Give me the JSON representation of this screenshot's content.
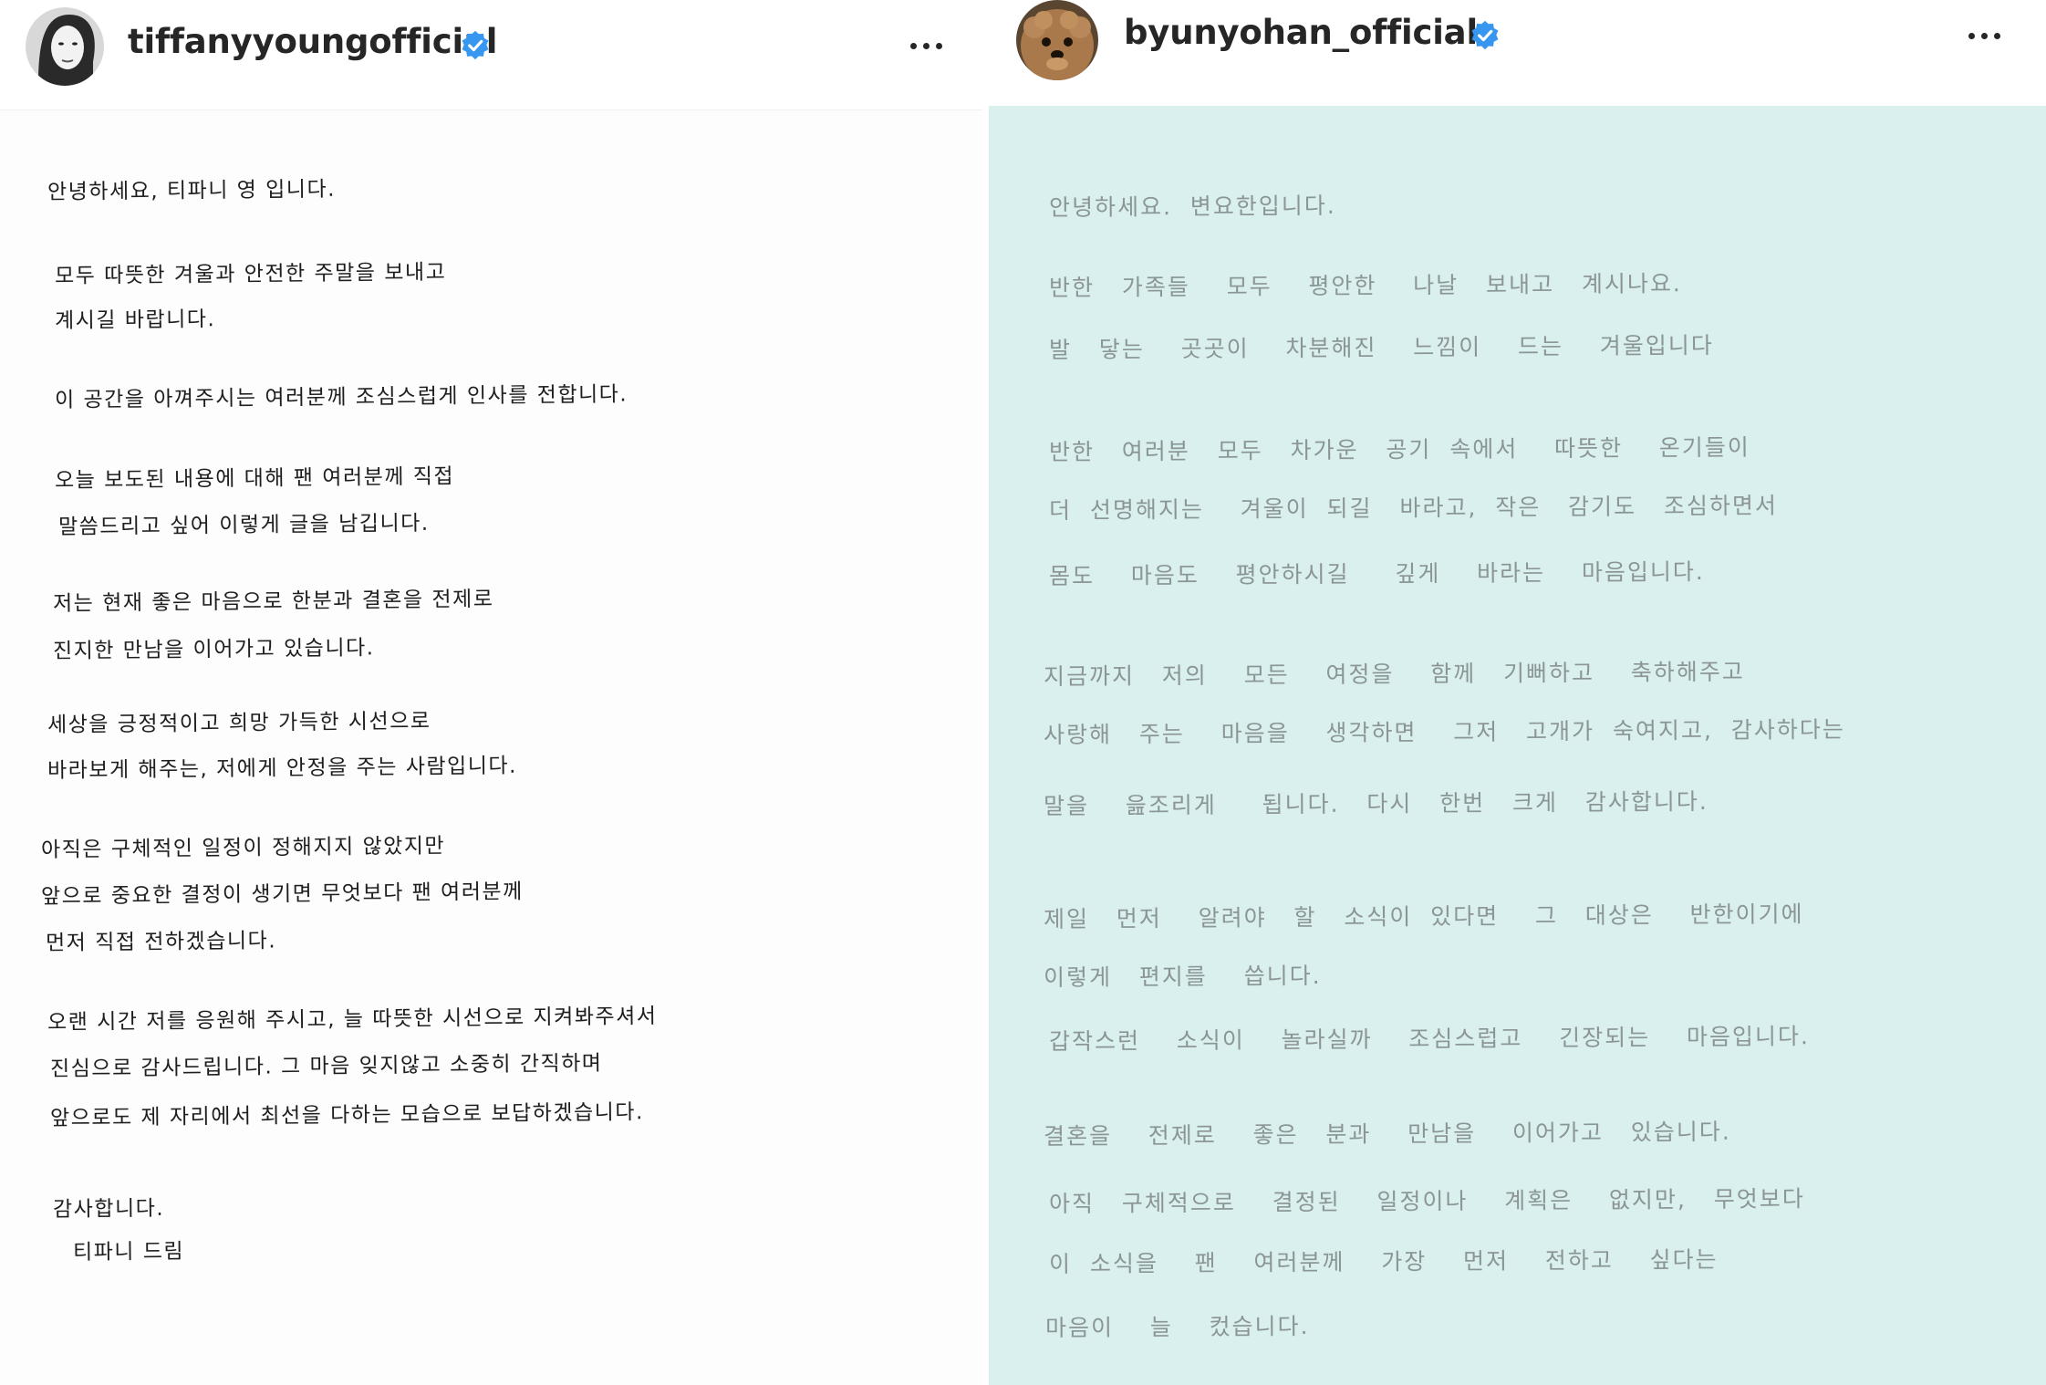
{
  "left_post": {
    "username": "tiffanyyoungofficial",
    "verified": true,
    "menu_icon": "more-horizontal-icon",
    "letter_background": "#fdfdfd",
    "letter_lines": [
      "안녕하세요, 티파니 영 입니다.",
      "모두 따뜻한 겨울과 안전한 주말을 보내고",
      "계시길 바랍니다.",
      "이 공간을 아껴주시는 여러분께 조심스럽게 인사를 전합니다.",
      "오늘 보도된 내용에 대해 팬 여러분께 직접",
      "말씀드리고 싶어 이렇게 글을 남깁니다.",
      "저는 현재 좋은 마음으로 한분과 결혼을 전제로",
      "진지한 만남을 이어가고 있습니다.",
      "세상을 긍정적이고 희망 가득한 시선으로",
      "바라보게 해주는, 저에게 안정을 주는 사람입니다.",
      "아직은 구체적인 일정이 정해지지 않았지만",
      "앞으로 중요한 결정이 생기면 무엇보다 팬 여러분께",
      "먼저 직접 전하겠습니다.",
      "오랜 시간 저를 응원해 주시고, 늘 따뜻한 시선으로 지켜봐주셔서",
      "진심으로 감사드립니다. 그 마음 잊지않고 소중히 간직하며",
      "앞으로도 제 자리에서 최선을 다하는 모습으로 보답하겠습니다.",
      "감사합니다.",
      "티파니 드림"
    ]
  },
  "right_post": {
    "username": "byunyohan_official",
    "verified": true,
    "menu_icon": "more-horizontal-icon",
    "letter_background": "#d9f0ef",
    "letter_lines": [
      "안녕하세요.  변요한입니다.",
      "반한   가족들    모두    평안한    나날   보내고   계시나요.",
      "발   닿는    곳곳이    차분해진    느낌이    드는    겨울입니다",
      "반한   여러분   모두   차가운   공기  속에서    따뜻한    온기들이",
      "더  선명해지는    겨울이  되길   바라고,  작은   감기도   조심하면서",
      "몸도    마음도    평안하시길     깊게    바라는    마음입니다.",
      "지금까지   저의    모든    여정을    함께   기뻐하고    축하해주고",
      "사랑해   주는    마음을    생각하면    그저   고개가  숙여지고,  감사하다는",
      "말을    읊조리게     됩니다.   다시   한번   크게   감사합니다.",
      "제일   먼저    알려야   할   소식이  있다면    그   대상은    반한이기에",
      "이렇게   편지를    씁니다.",
      "갑작스런    소식이    놀라실까    조심스럽고    긴장되는    마음입니다.",
      "결혼을    전제로    좋은   분과    만남을    이어가고   있습니다.",
      "아직   구체적으로    결정된    일정이나    계획은    없지만,   무엇보다",
      "이  소식을    팬    여러분께    가장    먼저    전하고    싶다는",
      "마음이    늘    컸습니다."
    ]
  }
}
